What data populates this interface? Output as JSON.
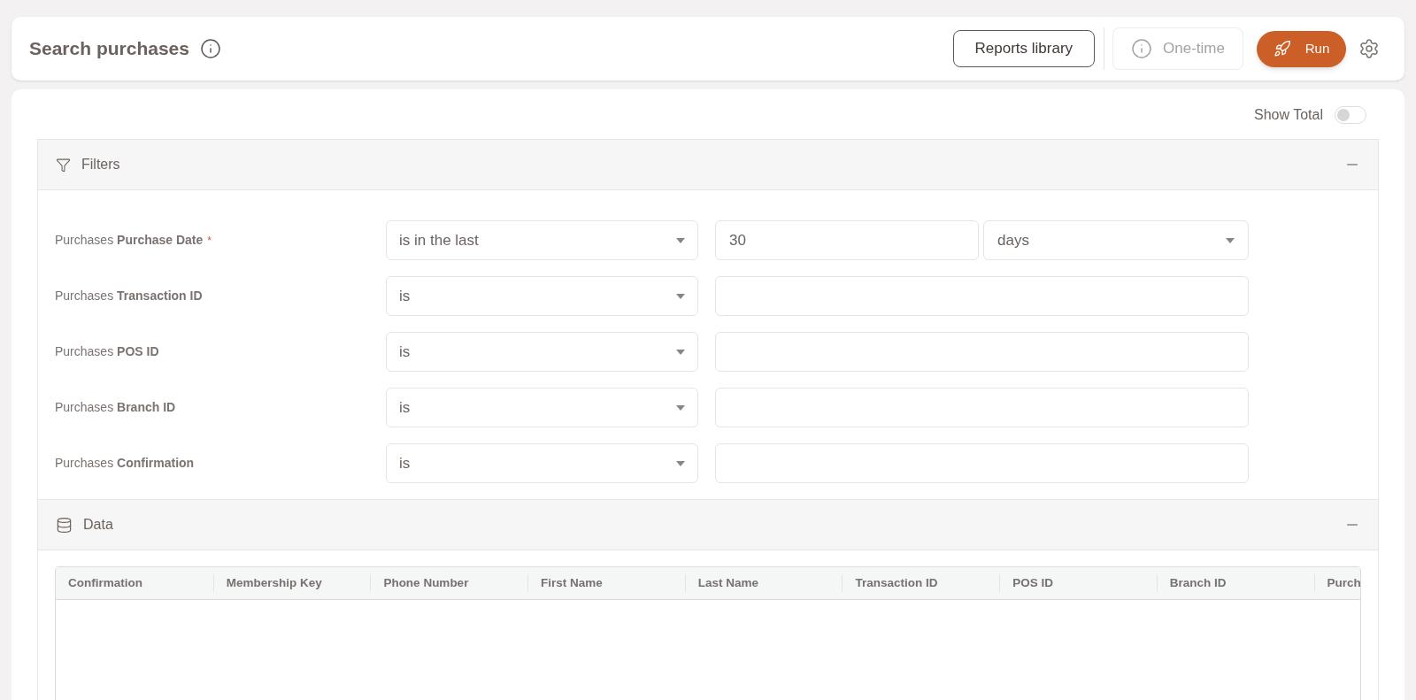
{
  "header": {
    "title": "Search purchases",
    "buttons": [
      {
        "label": "Reports library",
        "kind": "outline",
        "disabled": false
      },
      {
        "label": "One-time",
        "kind": "info",
        "disabled": true
      },
      {
        "label": "Run",
        "kind": "primary",
        "disabled": false
      }
    ]
  },
  "show_total": {
    "label": "Show Total",
    "on": false
  },
  "filters": {
    "title": "Filters",
    "expanded": true,
    "rows": [
      {
        "label": "Purchases **Purchase Date**",
        "required_mark": "*",
        "operator": "is in the last",
        "value": "30",
        "unit": "days"
      },
      {
        "label": "Purchases **Transaction ID**",
        "operator": "is"
      },
      {
        "label": "Purchases **POS ID**",
        "operator": "is"
      },
      {
        "label": "Purchases **Branch ID**",
        "operator": "is"
      },
      {
        "label": "Purchases **Confirmation**",
        "operator": "is"
      }
    ]
  },
  "data": {
    "title": "Data",
    "expanded": true,
    "table": {
      "columns": [
        "Confirmation",
        "Membership Key",
        "Phone Number",
        "First Name",
        "Last Name",
        "Transaction ID",
        "POS ID",
        "Branch ID",
        "Purch"
      ]
    }
  }
}
